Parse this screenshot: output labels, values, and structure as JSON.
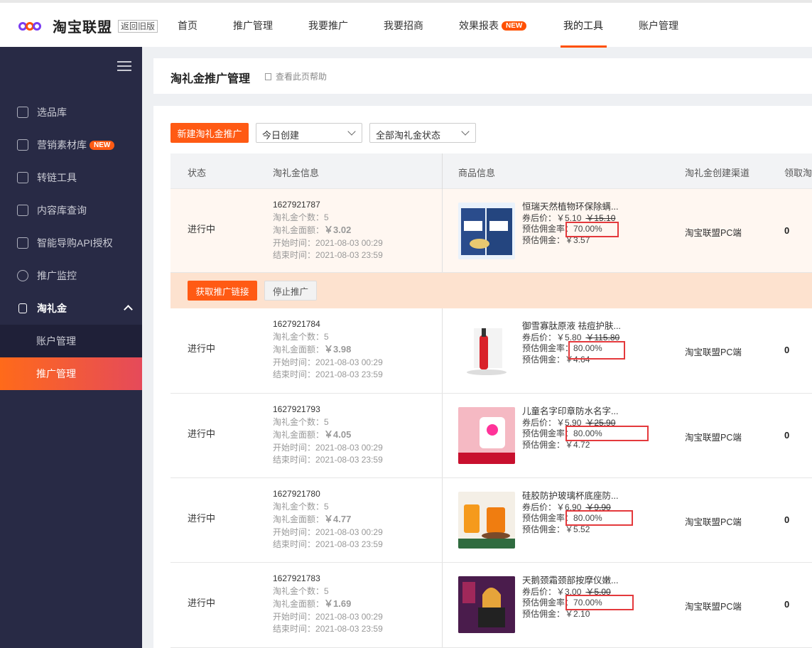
{
  "brand": {
    "name": "淘宝联盟",
    "old_version": "返回旧版"
  },
  "nav": {
    "items": [
      {
        "label": "首页"
      },
      {
        "label": "推广管理"
      },
      {
        "label": "我要推广"
      },
      {
        "label": "我要招商"
      },
      {
        "label": "效果报表",
        "badge": "NEW"
      },
      {
        "label": "我的工具",
        "active": true
      },
      {
        "label": "账户管理"
      }
    ]
  },
  "sidebar": {
    "items": [
      {
        "label": "选品库",
        "icon": "home-icon"
      },
      {
        "label": "营销素材库",
        "icon": "image-icon",
        "badge": "NEW"
      },
      {
        "label": "转链工具",
        "icon": "link-icon"
      },
      {
        "label": "内容库查询",
        "icon": "search-doc-icon"
      },
      {
        "label": "智能导购API授权",
        "icon": "api-icon"
      },
      {
        "label": "推广监控",
        "icon": "monitor-icon"
      },
      {
        "label": "淘礼金",
        "icon": "gift-icon",
        "expanded": true
      }
    ],
    "subitems": [
      {
        "label": "账户管理"
      },
      {
        "label": "推广管理",
        "active": true
      }
    ]
  },
  "header": {
    "title": "淘礼金推广管理",
    "help": "查看此页帮助"
  },
  "toolbar": {
    "new_button": "新建淘礼金推广",
    "date_filter": "今日创建",
    "status_filter": "全部淘礼金状态"
  },
  "table": {
    "columns": [
      "状态",
      "淘礼金信息",
      "商品信息",
      "淘礼金创建渠道",
      "领取淘"
    ],
    "labels": {
      "count": "淘礼金个数：",
      "face": "淘礼金面额：",
      "start": "开始时间：",
      "end": "结束时间：",
      "coupon_price": "券后价：",
      "rate": "预估佣金率：",
      "commission": "预估佣金："
    },
    "rows": [
      {
        "status": "进行中",
        "id": "1627921787",
        "count": "5",
        "face": "￥3.02",
        "start": "2021-08-03 00:29",
        "end": "2021-08-03 23:59",
        "title": "恒瑞天然植物环保除螨...",
        "price": "￥5.10",
        "orig": "￥15.10",
        "rate": "70.00%",
        "commission": "￥3.57",
        "channel": "淘宝联盟PC端",
        "claimed": "0"
      },
      {
        "status": "进行中",
        "id": "1627921784",
        "count": "5",
        "face": "￥3.98",
        "start": "2021-08-03 00:29",
        "end": "2021-08-03 23:59",
        "title": "御雪寡肽原液 祛痘护肤...",
        "price": "￥5.80",
        "orig": "￥115.80",
        "rate": "80.00%",
        "commission": "￥4.64",
        "channel": "淘宝联盟PC端",
        "claimed": "0"
      },
      {
        "status": "进行中",
        "id": "1627921793",
        "count": "5",
        "face": "￥4.05",
        "start": "2021-08-03 00:29",
        "end": "2021-08-03 23:59",
        "title": "儿童名字印章防水名字...",
        "price": "￥5.90",
        "orig": "￥25.90",
        "rate": "80.00%",
        "commission": "￥4.72",
        "channel": "淘宝联盟PC端",
        "claimed": "0"
      },
      {
        "status": "进行中",
        "id": "1627921780",
        "count": "5",
        "face": "￥4.77",
        "start": "2021-08-03 00:29",
        "end": "2021-08-03 23:59",
        "title": "硅胶防护玻璃杯底座防...",
        "price": "￥6.90",
        "orig": "￥9.90",
        "rate": "80.00%",
        "commission": "￥5.52",
        "channel": "淘宝联盟PC端",
        "claimed": "0"
      },
      {
        "status": "进行中",
        "id": "1627921783",
        "count": "5",
        "face": "￥1.69",
        "start": "2021-08-03 00:29",
        "end": "2021-08-03 23:59",
        "title": "天鹅颈霜颈部按摩仪嫩...",
        "price": "￥3.00",
        "orig": "￥5.00",
        "rate": "70.00%",
        "commission": "￥2.10",
        "channel": "淘宝联盟PC端",
        "claimed": "0"
      }
    ],
    "actions": {
      "get_link": "获取推广链接",
      "stop": "停止推广"
    }
  }
}
